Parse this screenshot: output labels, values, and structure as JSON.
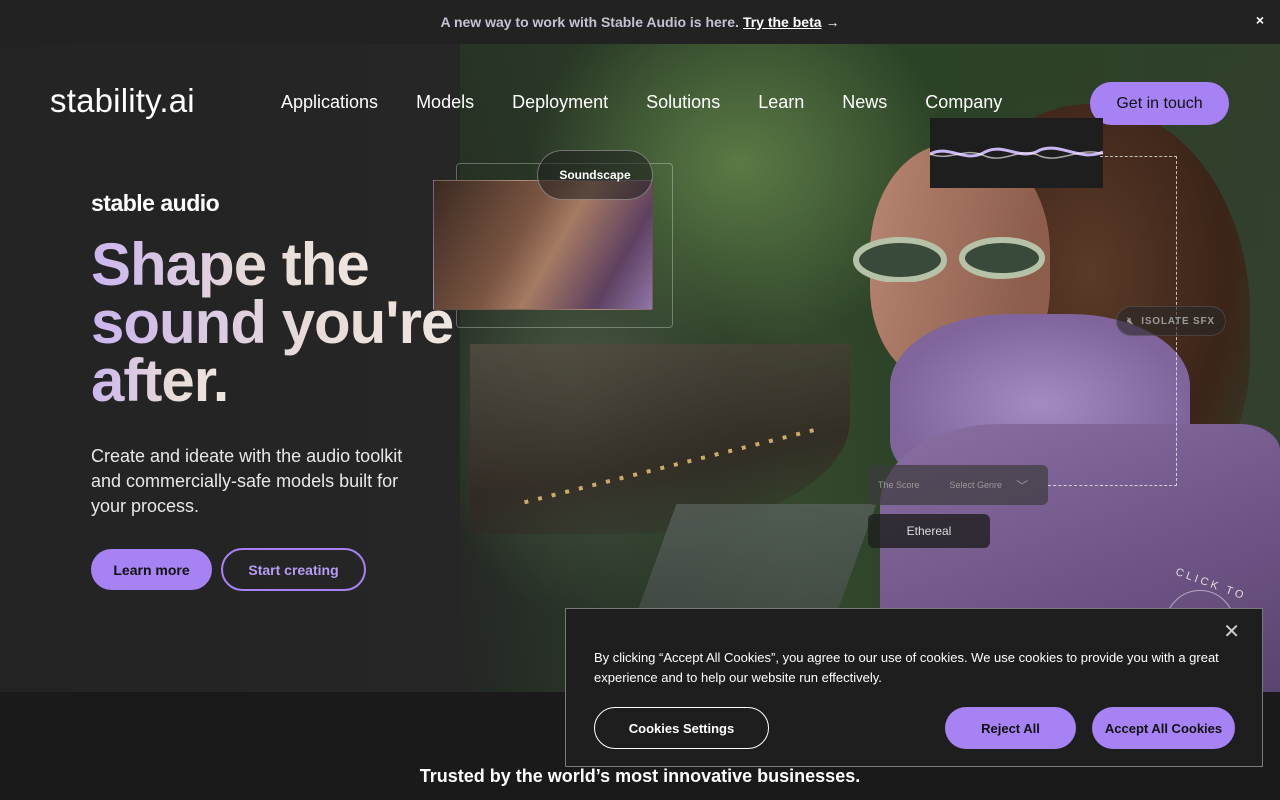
{
  "banner": {
    "text": "A new way to work with Stable Audio is here.",
    "link": "Try the beta",
    "arrow": "→",
    "close": "×"
  },
  "header": {
    "logo": "stability.ai",
    "nav": [
      "Applications",
      "Models",
      "Deployment",
      "Solutions",
      "Learn",
      "News",
      "Company"
    ],
    "cta": "Get in touch"
  },
  "hero": {
    "brand": "stable audio",
    "headline_lines": [
      "Shape the",
      "sound you're",
      "after."
    ],
    "subtext": "Create and ideate with the audio toolkit and commercially-safe models built for your process.",
    "learn_more": "Learn more",
    "start_creating": "Start creating"
  },
  "overlay": {
    "soundscape": "Soundscape",
    "isolate_sfx": "ISOLATE SFX",
    "score_label": "The Score",
    "select_genre": "Select Genre",
    "ethereal": "Ethereal",
    "click_text": "CLICK TO"
  },
  "footer": {
    "trusted": "Trusted by the world’s most innovative businesses."
  },
  "cookie": {
    "text": "By clicking “Accept All Cookies”, you agree to our use of cookies. We use cookies to provide you with a great experience and to help our website run effectively.",
    "settings": "Cookies Settings",
    "reject": "Reject All",
    "accept": "Accept All Cookies",
    "close": "✕"
  },
  "colors": {
    "accent": "#a782f5",
    "background": "#1a1a1a"
  }
}
